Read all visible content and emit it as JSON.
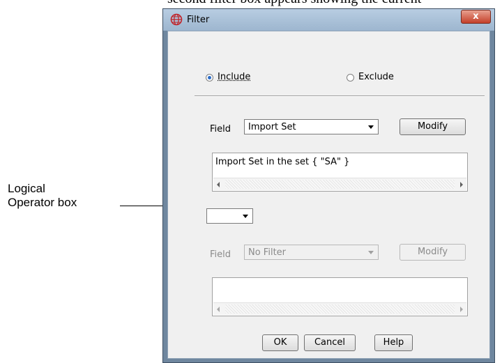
{
  "caption": {
    "top_text": "second filter box appears showing the current"
  },
  "annotation": {
    "line1": "Logical",
    "line2": "Operator box"
  },
  "window": {
    "title": "Filter",
    "icon": "globe-icon",
    "close_glyph": "x"
  },
  "filter_mode": {
    "include_label": "Include",
    "exclude_label": "Exclude",
    "selected": "Include"
  },
  "filter1": {
    "field_label": "Field",
    "field_value": "Import Set",
    "modify_label": "Modify",
    "expression": "Import Set in the set { \"SA\" }"
  },
  "logical_operator": {
    "value": ""
  },
  "filter2": {
    "field_label": "Field",
    "field_value": "No Filter",
    "modify_label": "Modify",
    "expression": ""
  },
  "buttons": {
    "ok": "OK",
    "cancel": "Cancel",
    "help": "Help"
  },
  "colors": {
    "close_button": "#c4402a",
    "radio_selected": "#2a6bc7",
    "window_frame": "#6f879f"
  }
}
